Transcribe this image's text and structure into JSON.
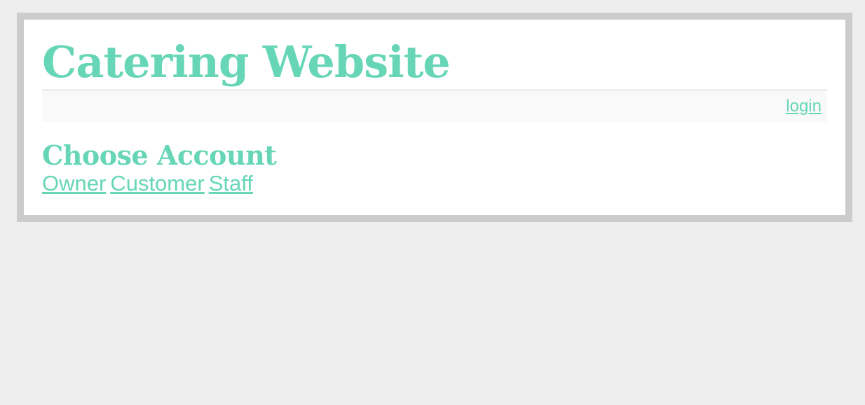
{
  "header": {
    "title": "Catering Website"
  },
  "nav": {
    "login_label": "login"
  },
  "main": {
    "heading": "Choose Account",
    "accounts": [
      "Owner",
      "Customer",
      "Staff"
    ]
  },
  "colors": {
    "accent": "#66d6b6",
    "frame_border": "#cccccc",
    "page_background": "#eeeeee",
    "navbar_background": "#f9f9f9"
  }
}
